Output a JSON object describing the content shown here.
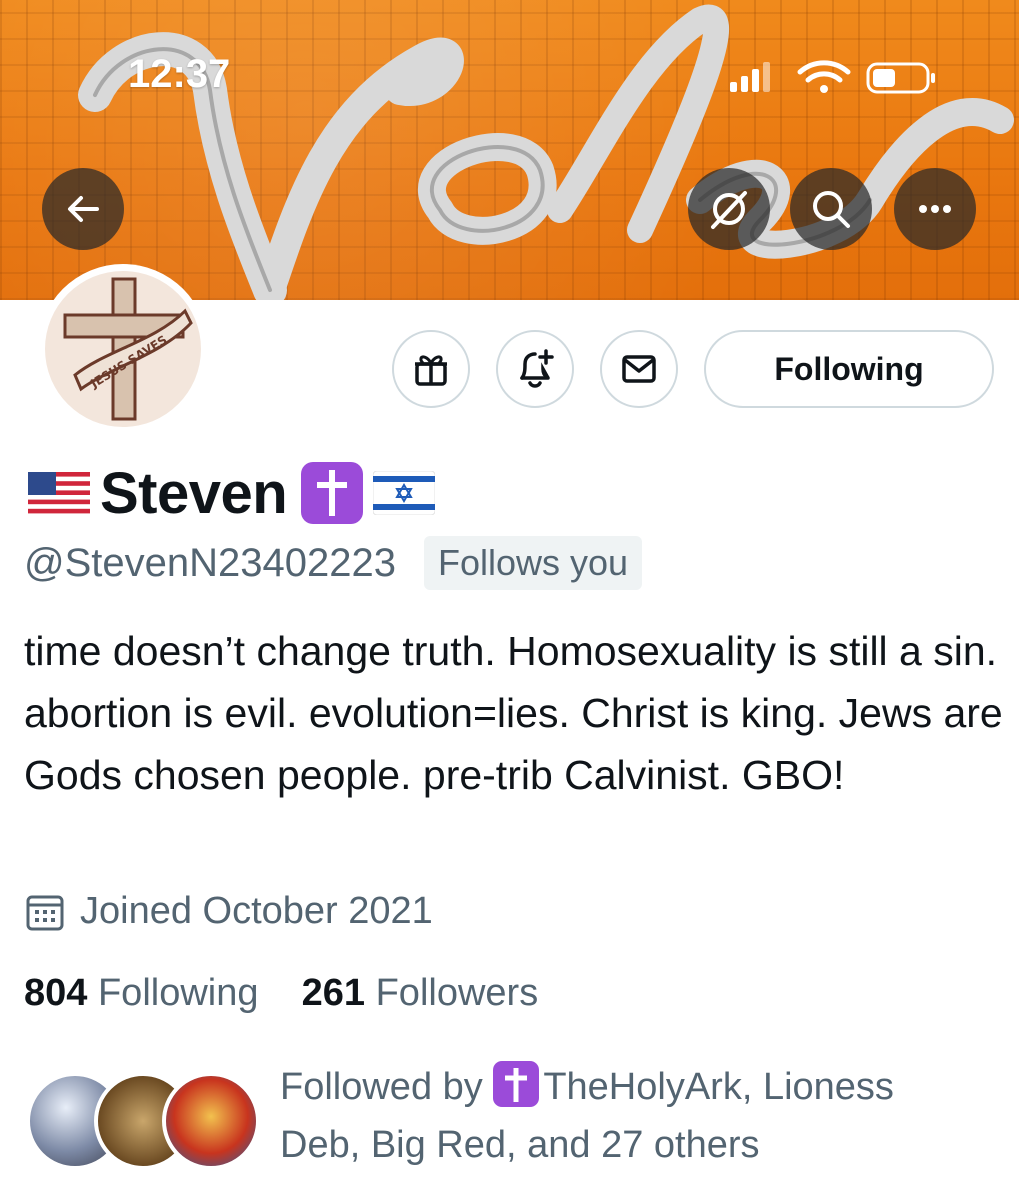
{
  "status_bar": {
    "time": "12:37"
  },
  "banner": {
    "text": "Vols"
  },
  "nav": {
    "back_icon": "arrow-left-icon",
    "grok_icon": "slash-circle-icon",
    "search_icon": "search-icon",
    "more_icon": "more-icon"
  },
  "avatar": {
    "text": "JESUS SAVES"
  },
  "actions": {
    "following_label": "Following"
  },
  "profile": {
    "flag_left": "🇺🇸",
    "name": "Steven",
    "flag_right": "🇮🇱",
    "handle": "@StevenN23402223",
    "follows_you": "Follows you",
    "bio": "time doesn’t change truth. Homosexuality is still a sin. abortion is evil. evolution=lies. Christ is king. Jews are Gods chosen people. pre-trib Calvinist. GBO!",
    "joined": "Joined October 2021"
  },
  "stats": {
    "following_count": "804",
    "following_label": "Following",
    "followers_count": "261",
    "followers_label": "Followers"
  },
  "followed_by": {
    "prefix": "Followed by",
    "names": "TheHolyArk, Lioness Deb, Big Red, and 27 others"
  },
  "colors": {
    "banner_orange": "#e9770f",
    "badge_purple": "#9b4bd9",
    "secondary_text": "#536471",
    "border": "#cfd9de"
  }
}
